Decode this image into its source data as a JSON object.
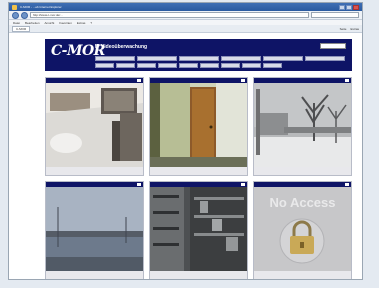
{
  "browser": {
    "title": "C-MOR - ...eb Internet Explorer",
    "address": "http://www.c-mor.de/...",
    "search_placeholder": "",
    "menu": [
      "Datei",
      "Bearbeiten",
      "Ansicht",
      "Favoriten",
      "Extras",
      "?"
    ],
    "tab_label": "C-MOR",
    "tab_tools": [
      "Seite",
      "Extras"
    ]
  },
  "app": {
    "logo": "C-MOR",
    "logo_sub": "",
    "title": "IP Videoüberwachung",
    "user": "",
    "lang_value": "",
    "header_link": "",
    "nav_row1": [
      "",
      "",
      "",
      "",
      "",
      ""
    ],
    "nav_row2": [
      "",
      "",
      "",
      "",
      "",
      "",
      "",
      "",
      ""
    ],
    "colors": {
      "brand": "#0e1466",
      "bar": "#0e1466"
    }
  },
  "cameras": [
    {
      "title": "",
      "icon": "snow-room-cam"
    },
    {
      "title": "",
      "icon": "door-cam"
    },
    {
      "title": "",
      "icon": "winter-tree-cam"
    },
    {
      "title": "",
      "icon": "lake-cam"
    },
    {
      "title": "",
      "icon": "warehouse-shelf-cam"
    },
    {
      "title": "",
      "icon": "padlock-icon",
      "no_access_text": "No Access"
    }
  ]
}
